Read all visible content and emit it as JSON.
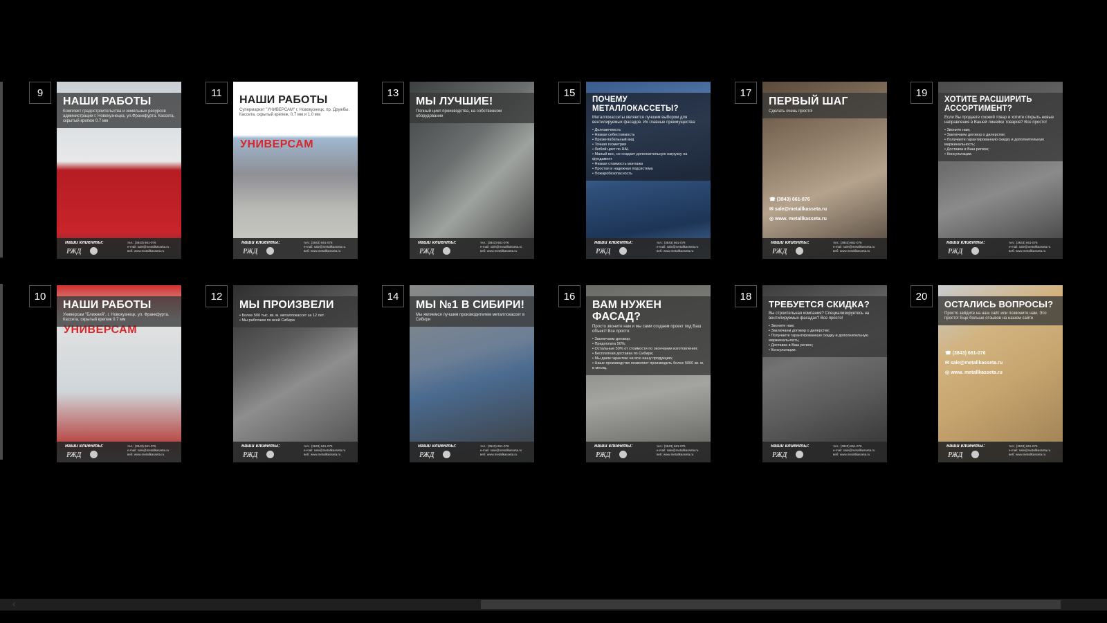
{
  "pages": [
    {
      "num": "9",
      "title": "НАШИ РАБОТЫ",
      "sub": "Комплект градостроительства и земельных ресурсов администрации г. Новокузнецка, ул.Франкфурта. Кассета, скрытый крепеж 0.7 мм",
      "style": "red"
    },
    {
      "num": "11",
      "title": "НАШИ РАБОТЫ",
      "sub": "Супермаркет \"УНИВЕРСАМ\" г. Новокузнецк, пр. Дружбы. Кассета, скрытый крепеж, 0.7 мм и 1.0 мм",
      "style": "white",
      "sign": "УНИВЕРСАМ"
    },
    {
      "num": "13",
      "title": "МЫ ЛУЧШИЕ!",
      "sub": "Полный цикл производства, на собственном оборудовании",
      "style": "worker"
    },
    {
      "num": "15",
      "title": "ПОЧЕМУ МЕТАЛЛОКАССЕТЫ?",
      "sub": "Металлокассеты являются лучшим выбором для вентилируемых фасадов. Их главные преимущества:",
      "list": [
        "Долговечность",
        "Низкая себестоимость",
        "Презентабельный вид",
        "Точная геометрия",
        "Любой цвет по RAL",
        "Малый вес, не создает дополнительную нагрузку на фундамент",
        "Низкая стоимость монтажа",
        "Простая и надежная подсистема",
        "Пожаробезопасность"
      ],
      "style": "glass"
    },
    {
      "num": "17",
      "title": "ПЕРВЫЙ ШАГ",
      "sub": "Сделать очень просто!",
      "style": "welder",
      "contacts": [
        "(3843) 661-076",
        "sale@metallkasseta.ru",
        "www. metallkasseta.ru"
      ]
    },
    {
      "num": "19",
      "title": "ХОТИТЕ РАСШИРИТЬ АССОРТИМЕНТ?",
      "sub": "Если Вы продаете схожий товар и хотите открыть новые направления в Вашей линейке товаров? Все просто!",
      "list": [
        "Звоните нам;",
        "Заключаем договор о дилерстве;",
        "Получаете гарантированную скидку и дополнительную маржинальность;",
        "Доставка в Ваш регион;",
        "Консультации."
      ],
      "style": "machine"
    },
    {
      "num": "10",
      "title": "НАШИ РАБОТЫ",
      "sub": "Универсам \"Ближний\", г. Новокузнецк, ул. Франкфурта. Кассета, скрытый крепеж 0.7 мм",
      "style": "store",
      "sign": "УНИВЕРСАМ"
    },
    {
      "num": "12",
      "title": "МЫ ПРОИЗВЕЛИ",
      "list": [
        "Более 500 тыс. кв. м. металлокассет за 12 лет.",
        "Мы работаем по всей Сибири"
      ],
      "style": "computer"
    },
    {
      "num": "14",
      "title": "МЫ №1 В СИБИРИ!",
      "sub": "Мы являемся лучшим производителем металлокассет в Сибири",
      "style": "bender"
    },
    {
      "num": "16",
      "title": "ВАМ НУЖЕН ФАСАД?",
      "sub": "Просто звоните нам и мы сами создаем проект под Ваш объект! Все просто:",
      "list": [
        "Заключаем договор;",
        "Предоплата 50%;",
        "Остальные 50% от стоимости по окончании изготовления;",
        "Бесплатная доставка по Сибири;",
        "Мы даем гарантию на всю нашу продукцию;",
        "Наше производство позволяет производить более 5000 кв. м. в месяц."
      ],
      "style": "frame"
    },
    {
      "num": "18",
      "title": "ТРЕБУЕТСЯ СКИДКА?",
      "sub": "Вы строительная компания? Специализируетесь на вентилируемых фасадах? Все просто!",
      "list": [
        "Звоните нам;",
        "Заключаем договор о дилерстве;",
        "Получаете гарантированную скидку и дополнительную маржинальность;",
        "Доставка в Ваш регион;",
        "Консультации."
      ],
      "style": "machine2"
    },
    {
      "num": "20",
      "title": "ОСТАЛИСЬ ВОПРОСЫ?",
      "sub": "Просто зайдите на наш сайт или позвоните нам. Это просто! Еще больше отзывов на нашем сайте",
      "style": "beige",
      "contacts": [
        "(3843) 661-076",
        "sale@metallkasseta.ru",
        "www. metallkasseta.ru"
      ]
    }
  ],
  "footer": {
    "label": "наши клиенты:",
    "logo": "РЖД",
    "contacts": [
      "тел.: (3843) 661-076",
      "e-mail: sale@metallkasseta.ru",
      "веб: www.metallkasseta.ru"
    ]
  },
  "scroll": {
    "arrow_icon": "chevron-left-icon",
    "thumb_fraction": 0.52
  }
}
